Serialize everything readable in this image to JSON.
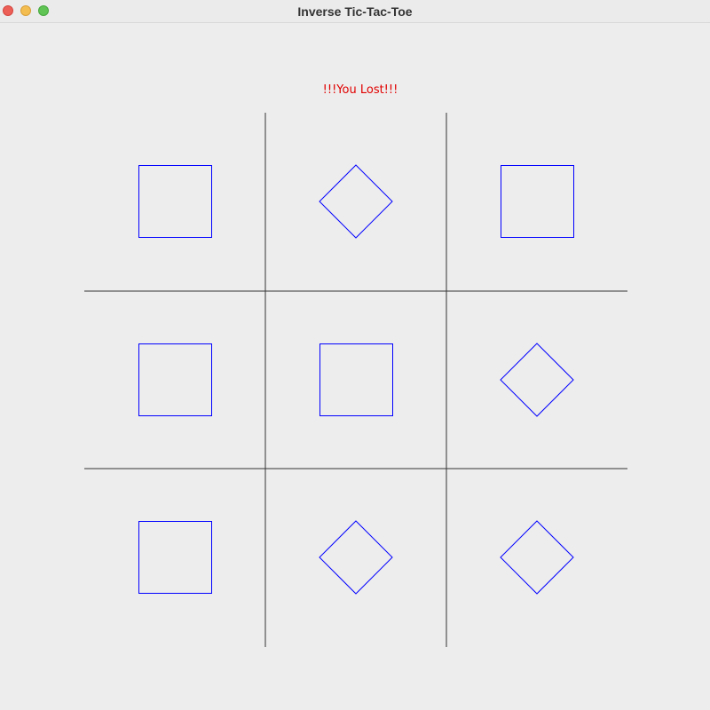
{
  "window": {
    "title": "Inverse Tic-Tac-Toe"
  },
  "game": {
    "status_text": "!!!You Lost!!!",
    "status_color": "#e00000",
    "grid_line_color": "#333333",
    "mark_color": "#0000ff",
    "board": [
      [
        "square",
        "diamond",
        "square"
      ],
      [
        "square",
        "square",
        "diamond"
      ],
      [
        "square",
        "diamond",
        "diamond"
      ]
    ]
  }
}
